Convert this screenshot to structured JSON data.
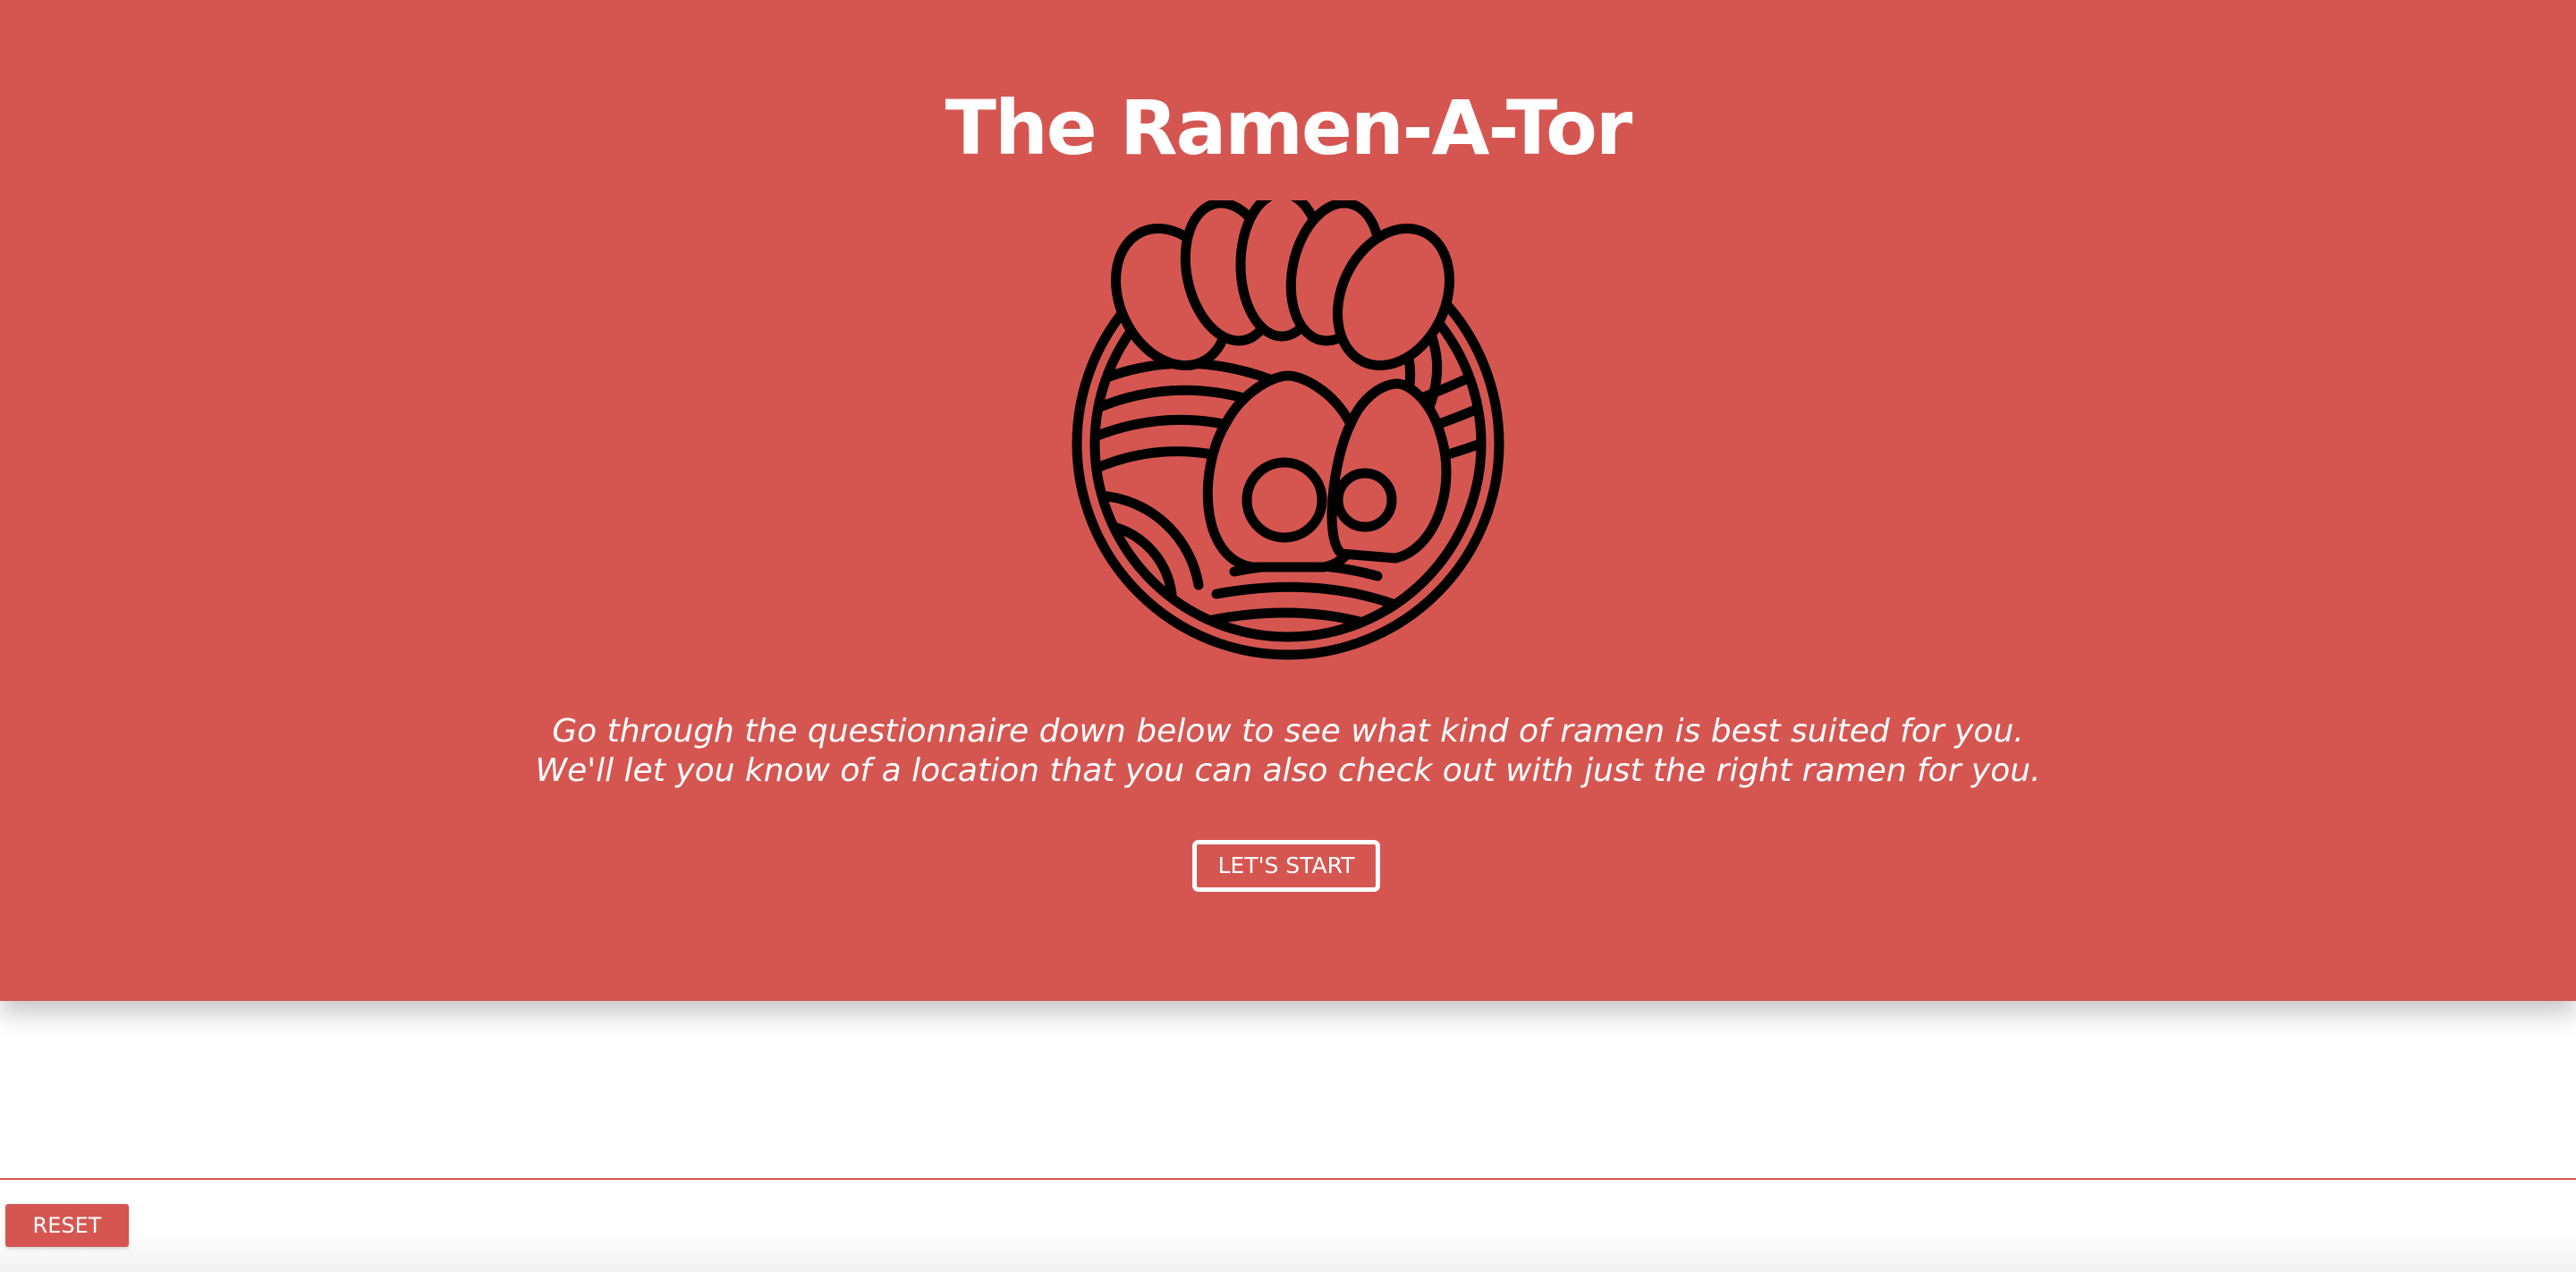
{
  "colors": {
    "brand_red": "#d55651",
    "white": "#ffffff",
    "logo_stroke": "#000000"
  },
  "hero": {
    "title": "The Ramen-A-Tor",
    "logo_icon": "ramen-bowl-icon",
    "tagline_line1": "Go through the questionnaire down below to see what kind of ramen is best suited for you.",
    "tagline_line2": "We'll let you know of a location that you can also check out with just the right ramen for you.",
    "start_label": "LET'S START"
  },
  "footer": {
    "reset_label": "RESET"
  }
}
